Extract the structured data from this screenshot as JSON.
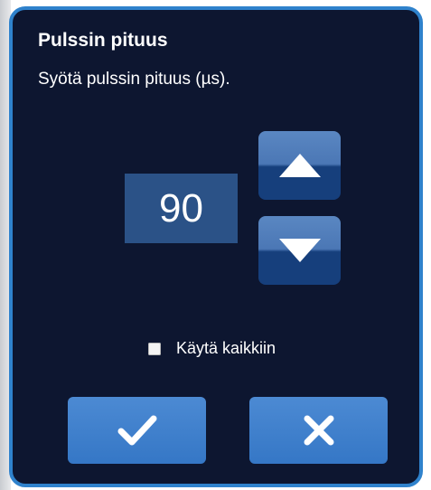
{
  "dialog": {
    "title": "Pulssin pituus",
    "subtitle": "Syötä pulssin pituus (µs).",
    "value": "90",
    "apply_all_label": "Käytä kaikkiin",
    "apply_all_checked": false
  },
  "icons": {
    "increase": "triangle-up-icon",
    "decrease": "triangle-down-icon",
    "confirm": "checkmark-icon",
    "cancel": "close-icon"
  },
  "colors": {
    "dialog_background": "#0d1630",
    "dialog_border": "#2f82cc",
    "value_box": "#2b5287",
    "action_button": "#3f82cc",
    "stepper_top": "#5a87c2",
    "stepper_bottom": "#163f7c"
  }
}
